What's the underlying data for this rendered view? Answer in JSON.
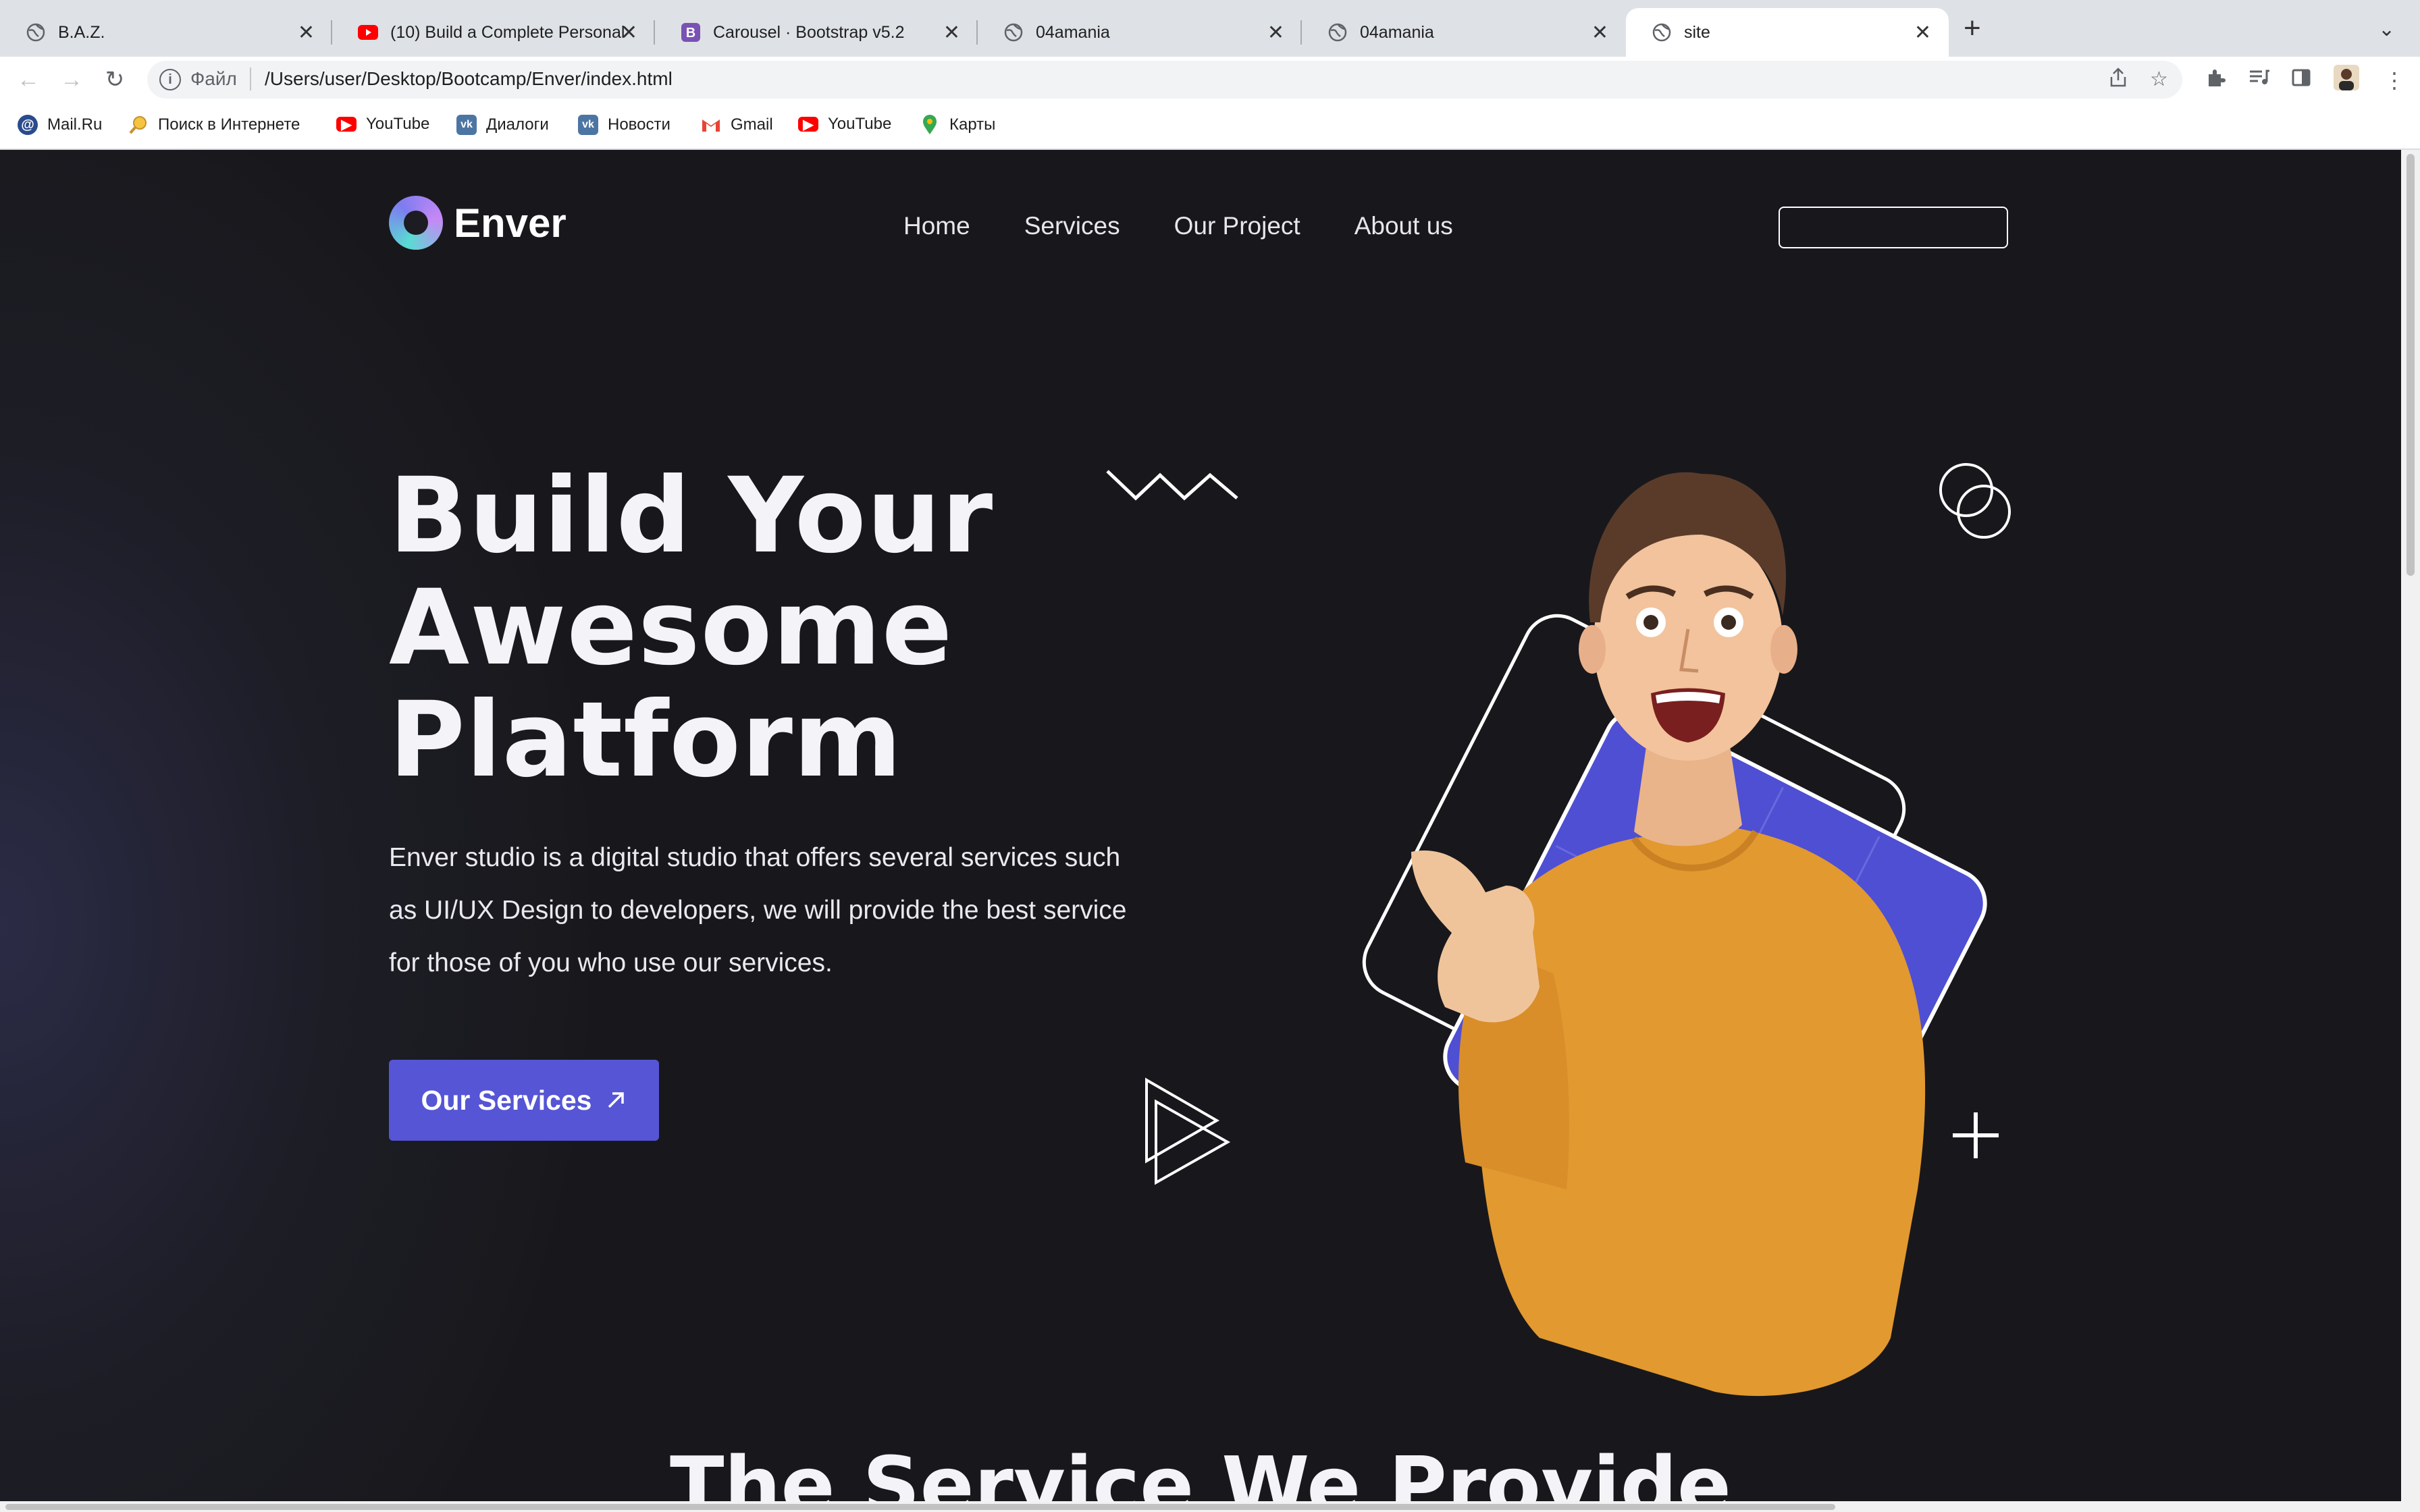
{
  "tabs": [
    {
      "title": "B.A.Z.",
      "icon": "globe-icon"
    },
    {
      "title": "(10) Build a Complete Personal",
      "icon": "youtube-icon"
    },
    {
      "title": "Carousel · Bootstrap v5.2",
      "icon": "bootstrap-icon"
    },
    {
      "title": "04amania",
      "icon": "globe-icon"
    },
    {
      "title": "04amania",
      "icon": "globe-icon"
    },
    {
      "title": "site",
      "icon": "globe-icon",
      "active": true
    }
  ],
  "address_bar": {
    "scheme_label": "Файл",
    "url": "/Users/user/Desktop/Bootcamp/Enver/index.html"
  },
  "bookmarks": [
    {
      "label": "Mail.Ru",
      "icon": "mailru-icon"
    },
    {
      "label": "Поиск в Интернете",
      "icon": "search-icon"
    },
    {
      "label": "YouTube",
      "icon": "youtube-icon"
    },
    {
      "label": "Диалоги",
      "icon": "vk-icon"
    },
    {
      "label": "Новости",
      "icon": "vk-icon"
    },
    {
      "label": "Gmail",
      "icon": "gmail-icon"
    },
    {
      "label": "YouTube",
      "icon": "youtube-icon"
    },
    {
      "label": "Карты",
      "icon": "maps-pin-icon"
    }
  ],
  "site": {
    "brand": "Enver",
    "nav": [
      "Home",
      "Services",
      "Our Project",
      "About us"
    ],
    "hero": {
      "title_lines": [
        "Build Your",
        "Awesome",
        "Platform"
      ],
      "description": "Enver studio is a digital studio that offers several services such as UI/UX Design to developers, we will provide the best service for those of you who use our services.",
      "button_label": "Our Services"
    },
    "section_title": "The Service We Provide"
  },
  "colors": {
    "accent": "#5555d6",
    "page_background": "#18181c",
    "sweater": "#e2992f"
  }
}
